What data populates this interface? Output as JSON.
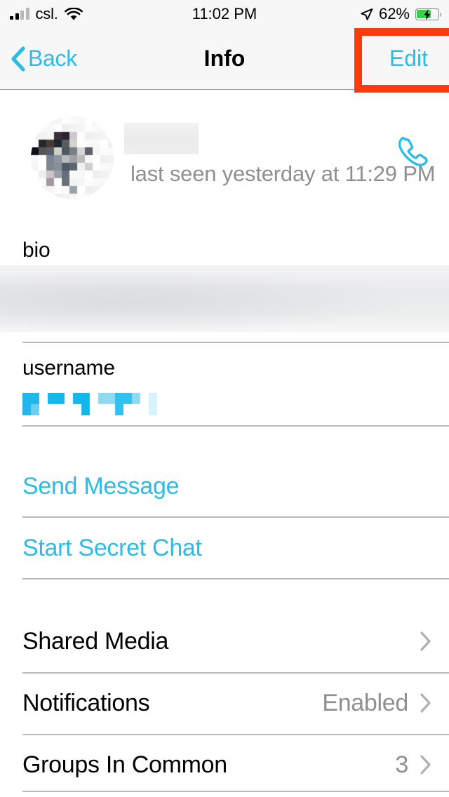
{
  "status_bar": {
    "carrier": "csl.",
    "signal_icon": "cellular-signal-icon",
    "wifi_icon": "wifi-icon",
    "time": "11:02 PM",
    "location_icon": "location-arrow-icon",
    "battery_percent": "62%",
    "battery_level": 62,
    "battery_charging": true,
    "battery_icon": "battery-charging-icon"
  },
  "nav_bar": {
    "back_label": "Back",
    "back_icon": "chevron-left-icon",
    "title": "Info",
    "edit_label": "Edit"
  },
  "annotation": {
    "target": "edit-button",
    "color": "#FB3B0C"
  },
  "profile": {
    "avatar_icon": "user-avatar-pixelated",
    "name_redacted": true,
    "last_seen": "last seen yesterday at 11:29 PM",
    "call_icon": "phone-call-icon",
    "call_icon_color": "#2BBBE6"
  },
  "bio_section": {
    "label": "bio",
    "value_blurred": true
  },
  "username_section": {
    "label": "username",
    "value_pixelated": true,
    "value_color": "#2BBBE6"
  },
  "actions": [
    {
      "label": "Send Message",
      "name": "send-message-button"
    },
    {
      "label": "Start Secret Chat",
      "name": "start-secret-chat-button"
    }
  ],
  "list_rows": [
    {
      "label": "Shared Media",
      "value": "",
      "chevron": "chevron-right-icon"
    },
    {
      "label": "Notifications",
      "value": "Enabled",
      "chevron": "chevron-right-icon"
    },
    {
      "label": "Groups In Common",
      "value": "3",
      "chevron": "chevron-right-icon"
    }
  ],
  "colors": {
    "accent": "#2BBBE6",
    "bar_background": "#f7f7f7",
    "secondary_text": "#8e8e93",
    "divider": "#b9b9bb",
    "highlight": "#FB3B0C"
  }
}
